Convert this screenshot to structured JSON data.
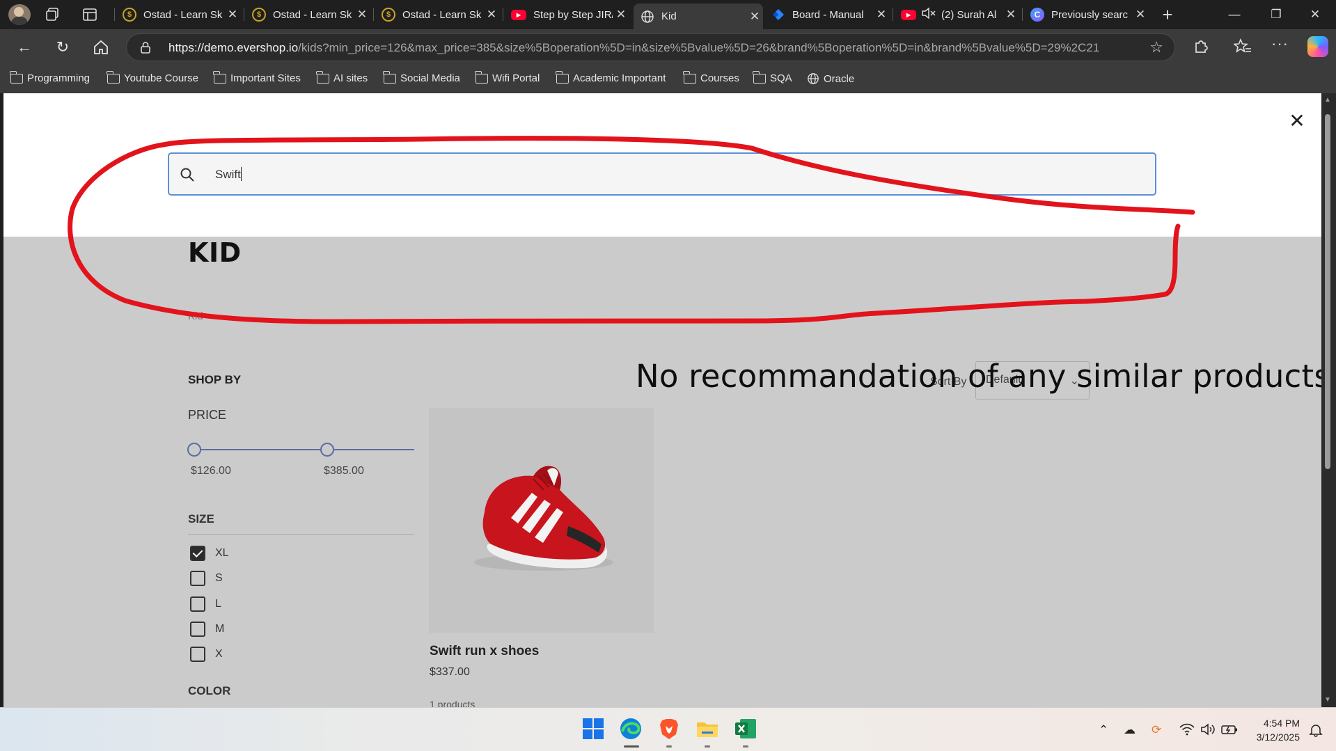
{
  "browser": {
    "tabs": [
      {
        "label": "Ostad - Learn Sk",
        "icon": "ostad-favicon"
      },
      {
        "label": "Ostad - Learn Sk",
        "icon": "ostad-favicon"
      },
      {
        "label": "Ostad - Learn Sk",
        "icon": "ostad-favicon"
      },
      {
        "label": "Step by Step JIR/",
        "icon": "youtube-favicon"
      },
      {
        "label": "Kid",
        "icon": "globe-favicon",
        "active": true
      },
      {
        "label": "Board - Manual",
        "icon": "jira-favicon"
      },
      {
        "label": "(2) Surah Al",
        "icon": "youtube-favicon",
        "muted": true
      },
      {
        "label": "Previously searc",
        "icon": "copilot-favicon"
      }
    ],
    "url_host": "https://demo.evershop.io",
    "url_path": "/kids?min_price=126&max_price=385&size%5Boperation%5D=in&size%5Bvalue%5D=26&brand%5Boperation%5D=in&brand%5Bvalue%5D=29%2C21",
    "bookmarks": [
      "Programming",
      "Youtube Course",
      "Important Sites",
      "AI sites",
      "Social Media",
      "Wifi Portal",
      "Academic Important",
      "Courses",
      "SQA",
      "Oracle"
    ]
  },
  "search": {
    "value": "Swift"
  },
  "page": {
    "title": "KID",
    "breadcrumb": "Kid",
    "shop_by": "SHOP BY",
    "price_heading": "PRICE",
    "price_min": "$126.00",
    "price_max": "$385.00",
    "price_range": [
      126,
      385
    ],
    "size_heading": "SIZE",
    "sizes": [
      {
        "label": "XL",
        "checked": true
      },
      {
        "label": "S",
        "checked": false
      },
      {
        "label": "L",
        "checked": false
      },
      {
        "label": "M",
        "checked": false
      },
      {
        "label": "X",
        "checked": false
      }
    ],
    "color_heading": "COLOR",
    "sort_by_label": "Sort By",
    "sort_value": "Default",
    "product": {
      "name": "Swift run x shoes",
      "price": "$337.00"
    },
    "product_count": "1 products"
  },
  "annotation": {
    "text": "No recommandation of any similar products",
    "color": "#e3131b"
  },
  "taskbar": {
    "time": "4:54 PM",
    "date": "3/12/2025"
  }
}
